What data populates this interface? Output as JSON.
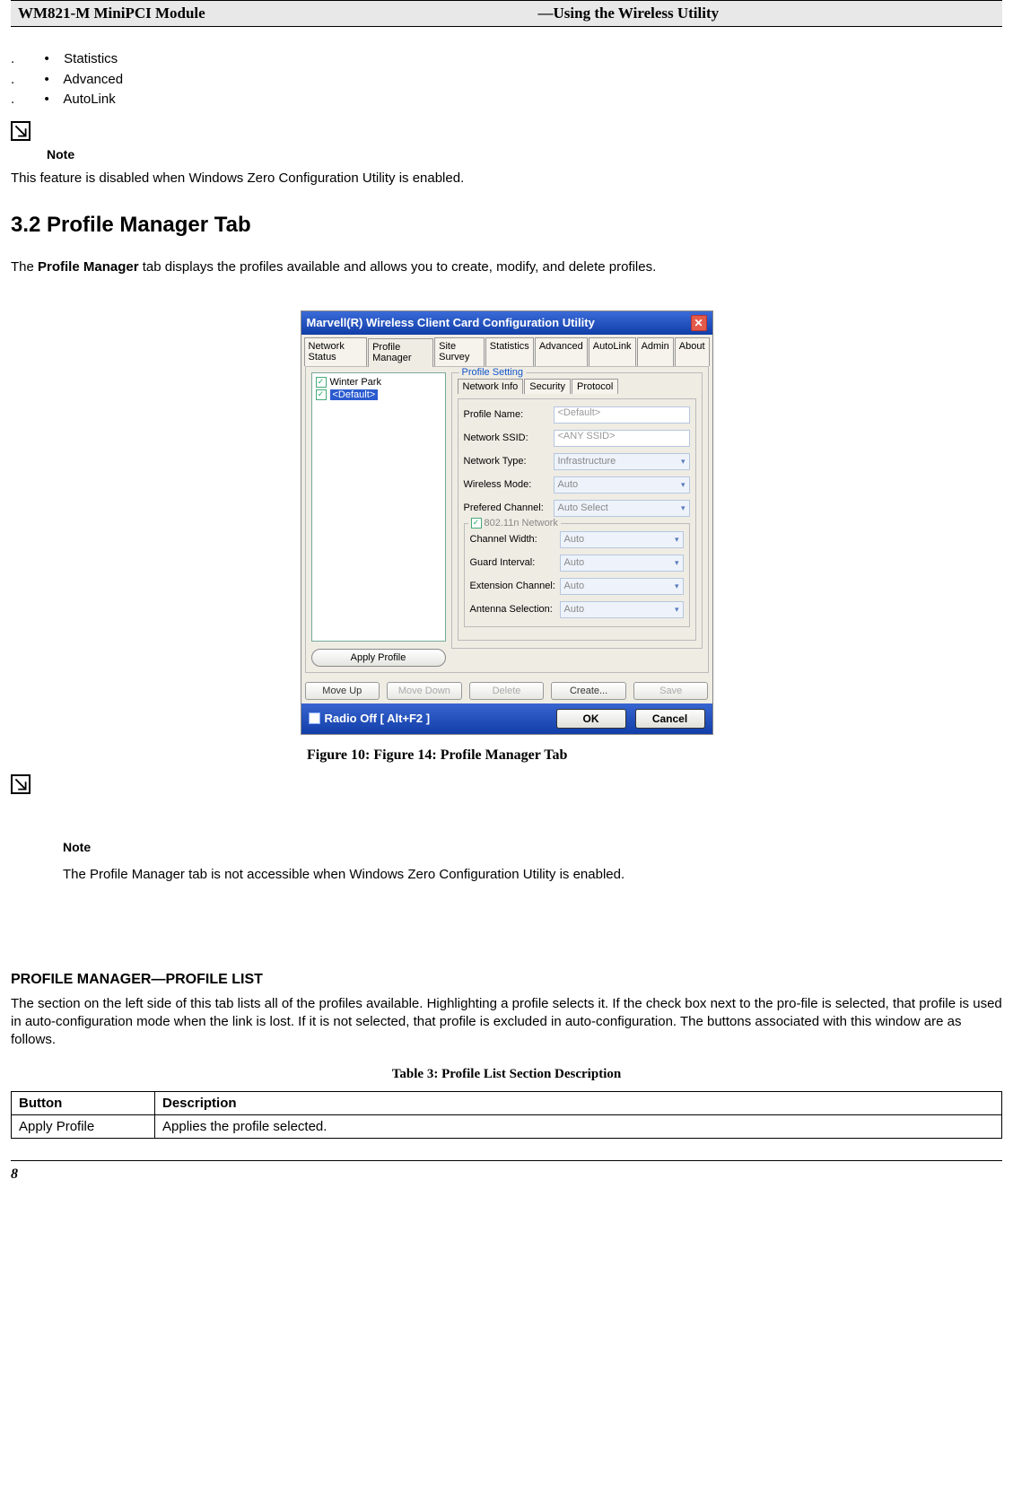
{
  "header": {
    "left": "WM821-M MiniPCI Module",
    "right": "—Using the Wireless Utility"
  },
  "bullets": [
    "Statistics",
    "Advanced",
    "AutoLink"
  ],
  "note1": {
    "label": "Note",
    "text": "This feature is disabled when Windows Zero Configuration Utility is enabled."
  },
  "section": {
    "num_title": "3.2 Profile Manager Tab",
    "intro_prefix": "The ",
    "intro_bold": "Profile Manager",
    "intro_suffix": " tab displays the profiles available and allows you to create, modify, and delete profiles."
  },
  "fig": {
    "window_title": "Marvell(R) Wireless Client Card Configuration Utility",
    "tabs": [
      "Network Status",
      "Profile Manager",
      "Site Survey",
      "Statistics",
      "Advanced",
      "AutoLink",
      "Admin",
      "About"
    ],
    "active_tab_index": 1,
    "profiles": [
      {
        "name": "Winter Park",
        "checked": true,
        "selected": false
      },
      {
        "name": "<Default>",
        "checked": true,
        "selected": true
      }
    ],
    "apply_profile": "Apply Profile",
    "profile_setting_label": "Profile Setting",
    "inner_tabs": [
      "Network Info",
      "Security",
      "Protocol"
    ],
    "inner_active_index": 0,
    "fields": {
      "profile_name": {
        "label": "Profile Name:",
        "value": "<Default>"
      },
      "network_ssid": {
        "label": "Network SSID:",
        "value": "<ANY SSID>"
      },
      "network_type": {
        "label": "Network Type:",
        "value": "Infrastructure"
      },
      "wireless_mode": {
        "label": "Wireless Mode:",
        "value": "Auto"
      },
      "pref_channel": {
        "label": "Prefered Channel:",
        "value": "Auto Select"
      },
      "subgroup_label": "802.11n Network",
      "channel_width": {
        "label": "Channel Width:",
        "value": "Auto"
      },
      "guard_interval": {
        "label": "Guard Interval:",
        "value": "Auto"
      },
      "ext_channel": {
        "label": "Extension Channel:",
        "value": "Auto"
      },
      "antenna": {
        "label": "Antenna Selection:",
        "value": "Auto"
      }
    },
    "buttons": {
      "move_up": "Move Up",
      "move_down": "Move Down",
      "delete": "Delete",
      "create": "Create...",
      "save": "Save"
    },
    "footer": {
      "radio_off": "Radio Off  [ Alt+F2 ]",
      "ok": "OK",
      "cancel": "Cancel"
    }
  },
  "caption": {
    "prefix": "Figure 10: ",
    "title": "Figure 14: Profile Manager Tab"
  },
  "note2": {
    "label": "Note",
    "text": "The Profile Manager tab is not accessible when Windows Zero Configuration Utility is enabled."
  },
  "subsection": {
    "title": "PROFILE MANAGER—PROFILE LIST",
    "para": "The section on the left side of this tab lists all of the profiles available. Highlighting a profile selects it. If the check box next to the pro-file is selected, that profile is used in auto-configuration mode when the link is lost. If it is not selected, that profile is excluded in auto-configuration. The buttons associated with this window are as follows."
  },
  "table": {
    "caption": "Table 3: Profile List Section Description",
    "headers": [
      "Button",
      "Description"
    ],
    "rows": [
      [
        "Apply Profile",
        "Applies the profile selected."
      ]
    ]
  },
  "page_number": "8"
}
